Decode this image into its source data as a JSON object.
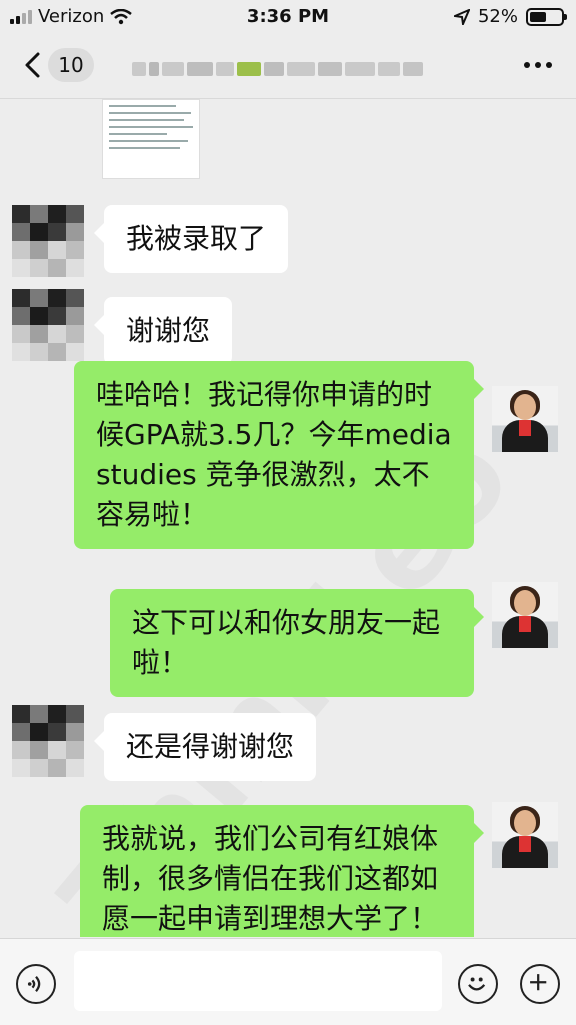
{
  "status": {
    "carrier": "Verizon",
    "time": "3:36 PM",
    "battery": "52%"
  },
  "nav": {
    "unread_count": "10"
  },
  "messages": [
    {
      "side": "left",
      "text": "我被录取了"
    },
    {
      "side": "left",
      "text": "谢谢您"
    },
    {
      "side": "right",
      "text": "哇哈哈！我记得你申请的时候GPA就3.5几？今年media studies 竞争很激烈，太不容易啦！"
    },
    {
      "side": "right",
      "text": "这下可以和你女朋友一起啦！"
    },
    {
      "side": "left",
      "text": "还是得谢谢您"
    },
    {
      "side": "right",
      "text": "我就说，我们公司有红娘体制，很多情侣在我们这都如愿一起申请到理想大学了！"
    }
  ],
  "colors": {
    "outgoing_bubble": "#95ec69",
    "incoming_bubble": "#ffffff",
    "background": "#ededed"
  },
  "icons": [
    "signal-icon",
    "wifi-icon",
    "location-icon",
    "battery-icon",
    "back-icon",
    "more-icon",
    "voice-icon",
    "emoji-icon",
    "plus-icon"
  ]
}
